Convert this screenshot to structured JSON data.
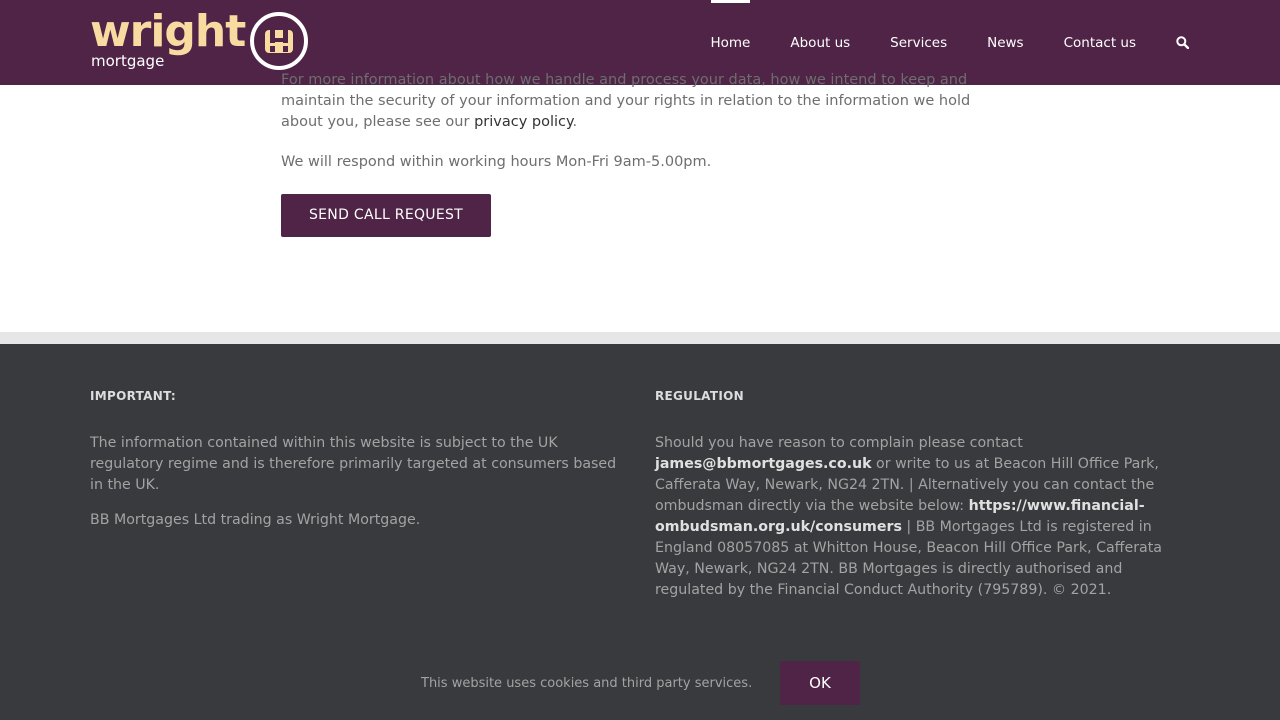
{
  "brand": {
    "logo_word": "wright",
    "logo_sub": "mortgage",
    "colors": {
      "primary": "#4f2447",
      "accent": "#f7dba0",
      "footer_bg": "#393a3d"
    }
  },
  "nav": {
    "items": [
      {
        "label": "Home",
        "active": true
      },
      {
        "label": "About us"
      },
      {
        "label": "Services"
      },
      {
        "label": "News"
      },
      {
        "label": "Contact us"
      }
    ],
    "search_icon": "search-icon"
  },
  "main": {
    "partial_line": "For more information about how we handle and process your data, how we intend to keep and",
    "privacy_before": "maintain the security of your information and your rights in relation to the information we hold about you, please see our ",
    "privacy_link": "privacy policy",
    "privacy_after": ".",
    "response_text": "We will respond within working hours Mon-Fri 9am-5.00pm.",
    "send_button": "SEND CALL REQUEST"
  },
  "footer": {
    "important": {
      "heading": "IMPORTANT:",
      "p1": "The information contained within this website is subject to the UK regulatory regime and is therefore primarily targeted at consumers based in the UK.",
      "p2": "BB Mortgages Ltd trading as Wright Mortgage."
    },
    "regulation": {
      "heading": "REGULATION",
      "t1": "Should you have reason to complain please contact ",
      "email": "james@bbmortgages.co.uk",
      "t2": " or write to us at Beacon Hill Office Park, Cafferata Way, Newark, NG24 2TN. | Alternatively you can contact the ombudsman directly via the website below: ",
      "link": "https://www.financial-ombudsman.org.uk/consumers",
      "t3": " | BB Mortgages Ltd is registered in England 08057085 at Whitton House, Beacon Hill Office Park, Cafferata Way, Newark, NG24 2TN. BB Mortgages is directly authorised and regulated by the Financial Conduct Authority (795789). © 2021."
    }
  },
  "cookie": {
    "text": "This website uses cookies and third party services.",
    "ok": "OK"
  }
}
